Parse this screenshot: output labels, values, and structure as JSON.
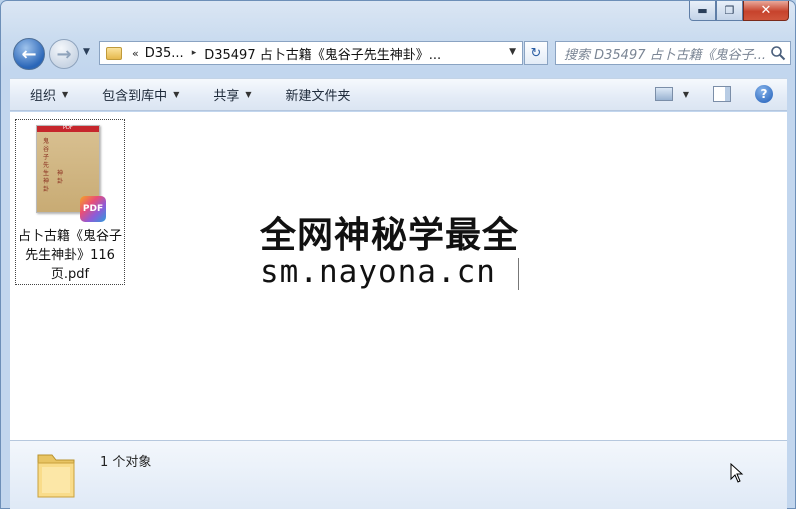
{
  "window": {
    "minimize": "▬",
    "maximize": "❐",
    "close": "✕"
  },
  "nav": {
    "back": "←",
    "forward": "→",
    "history_caret": "▼",
    "breadcrumb_prefix": "«",
    "crumbs": [
      "D35...",
      "D35497 占卜古籍《鬼谷子先生神卦》..."
    ],
    "crumb_arrow": "▸",
    "address_dropdown": "▼",
    "refresh": "↻",
    "search_placeholder": "搜索 D35497 占卜古籍《鬼谷子..."
  },
  "toolbar": {
    "organize": "组织",
    "include_library": "包含到库中",
    "share": "共享",
    "new_folder": "新建文件夹",
    "caret": "▼",
    "help": "?"
  },
  "file": {
    "thumb_header": "PDF",
    "thumb_title": "鬼谷子先生神卦",
    "thumb_subtitle": "神卦",
    "badge": "PDF",
    "name": "占卜古籍《鬼谷子先生神卦》116页.pdf"
  },
  "watermark": {
    "line1": "全网神秘学最全",
    "line2": "sm.nayona.cn"
  },
  "details": {
    "status": "1 个对象"
  }
}
